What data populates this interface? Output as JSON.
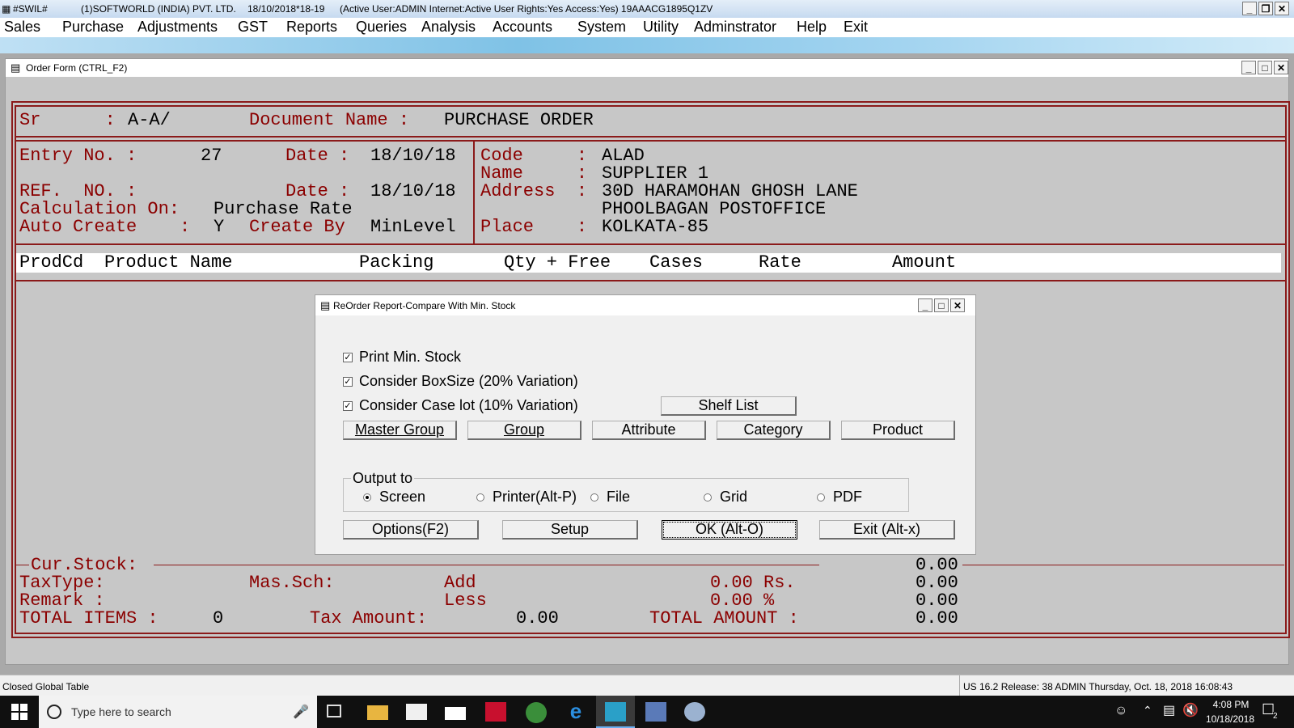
{
  "titlebar": {
    "app_id": "#SWIL#",
    "company": "(1)SOFTWORLD (INDIA) PVT. LTD.",
    "date_fy": "18/10/2018*18-19",
    "status": "(Active User:ADMIN Internet:Active  User Rights:Yes Access:Yes) 19AAACG1895Q1ZV"
  },
  "menu": [
    "Sales",
    "Purchase",
    "Adjustments",
    "GST",
    "Reports",
    "Queries",
    "Analysis",
    "Accounts",
    "System",
    "Utility",
    "Adminstrator",
    "Help",
    "Exit"
  ],
  "order_window": {
    "title": "Order Form (CTRL_F2)",
    "sr_label": "Sr      :",
    "sr_value": "A-A/",
    "doc_label": "Document Name :",
    "doc_value": "PURCHASE ORDER",
    "entry_label": "Entry No. :",
    "entry_value": "27",
    "date1_label": "Date :",
    "date1_value": "18/10/18",
    "ref_label": "REF.  NO. :",
    "date2_label": "Date :",
    "date2_value": "18/10/18",
    "calc_label": "Calculation On:",
    "calc_value": "Purchase Rate",
    "auto_label": "Auto Create    :",
    "auto_value": "Y",
    "createby_label": "Create By",
    "createby_value": "MinLevel",
    "code_label": "Code     :",
    "code_value": "ALAD",
    "name_label": "Name     :",
    "name_value": "SUPPLIER 1",
    "address_label": "Address  :",
    "address_line1": "30D HARAMOHAN GHOSH LANE",
    "address_line2": "PHOOLBAGAN POSTOFFICE",
    "place_label": "Place    :",
    "place_value": "KOLKATA-85",
    "columns": [
      "ProdCd",
      "Product Name",
      "Packing",
      "Qty + Free",
      "Cases",
      "Rate",
      "Amount"
    ],
    "curstock_label": "Cur.Stock:",
    "curstock_value": "0.00",
    "taxtype_label": "TaxType:",
    "massch_label": "Mas.Sch:",
    "add_label": "Add",
    "add_value": "0.00 Rs.",
    "add_total": "0.00",
    "remark_label": "Remark :",
    "less_label": "Less",
    "less_value": "0.00 %",
    "less_total": "0.00",
    "total_items_label": "TOTAL ITEMS :",
    "total_items_value": "0",
    "tax_amount_label": "Tax Amount:",
    "tax_amount_value": "0.00",
    "total_amount_label": "TOTAL AMOUNT :",
    "total_amount_value": "0.00"
  },
  "dialog": {
    "title": "ReOrder Report-Compare With Min. Stock",
    "checkboxes": [
      {
        "label": "Print Min. Stock",
        "checked": true
      },
      {
        "label": "Consider BoxSize (20% Variation)",
        "checked": true
      },
      {
        "label": "Consider Case lot (10% Variation)",
        "checked": true
      }
    ],
    "shelf_list": "Shelf List",
    "filter_buttons": [
      "Master Group",
      "Group",
      "Attribute",
      "Category",
      "Product"
    ],
    "output_label": "Output to",
    "outputs": [
      {
        "label": "Screen",
        "selected": true
      },
      {
        "label": "Printer(Alt-P)",
        "selected": false
      },
      {
        "label": "File",
        "selected": false
      },
      {
        "label": "Grid",
        "selected": false
      },
      {
        "label": "PDF",
        "selected": false
      }
    ],
    "action_buttons": [
      "Options(F2)",
      "Setup",
      "OK (Alt-O)",
      "Exit (Alt-x)"
    ]
  },
  "statusbar": {
    "left": "Closed Global Table",
    "right": "US 16.2 Release: 38 ADMIN  Thursday, Oct. 18, 2018  16:08:43"
  },
  "taskbar": {
    "search_placeholder": "Type here to search",
    "time": "4:08 PM",
    "date": "10/18/2018",
    "notification_count": "2"
  },
  "colors": {
    "accent_red": "#8b0000",
    "title_blue": "#c6daf0",
    "taskbar": "#101010"
  }
}
